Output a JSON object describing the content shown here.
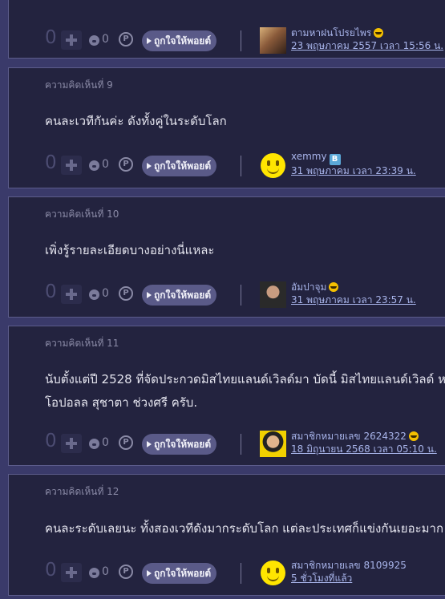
{
  "like_label": "ถูกใจให้พอยต์",
  "comments": [
    {
      "number_label": "",
      "text_lines": [],
      "score": "0",
      "emotion_count": "0",
      "user": "ตามหาฝนโปรยไพร",
      "date": "23 พฤษภาคม 2557 เวลา 15:56 น.",
      "badge_icon": "laughing-face-icon",
      "avatar_icon": "user-photo-avatar"
    },
    {
      "number_label": "ความคิดเห็นที่ 9",
      "text_lines": [
        "คนละเวทีกันค่ะ ดังทั้งคู่ในระดับโลก"
      ],
      "score": "0",
      "emotion_count": "0",
      "user": "xemmy",
      "date": "31 พฤษภาคม เวลา 23:39 น.",
      "badge_icon": "blue-badge-icon",
      "avatar_icon": "smiley-avatar"
    },
    {
      "number_label": "ความคิดเห็นที่ 10",
      "text_lines": [
        "เพิ่งรู้รายละเอียดบางอย่างนี่แหละ"
      ],
      "score": "0",
      "emotion_count": "0",
      "user": "อัมปาจุม",
      "date": "31 พฤษภาคม เวลา 23:57 น.",
      "badge_icon": "laughing-face-icon",
      "avatar_icon": "user-photo-avatar"
    },
    {
      "number_label": "ความคิดเห็นที่ 11",
      "text_lines": [
        "นับตั้งแต่ปี 2528 ที่จัดประกวดมิสไทยแลนด์เวิลด์มา บัดนี้ มิสไทยแลนด์เวิลด์ ห",
        "โอปอลล สุชาตา ช่วงศรี ครับ."
      ],
      "score": "0",
      "emotion_count": "0",
      "user": "สมาชิกหมายเลข 2624322",
      "date": "18 มิถุนายน 2568 เวลา 05:10 น.",
      "badge_icon": "laughing-face-icon",
      "avatar_icon": "user-photo-avatar"
    },
    {
      "number_label": "ความคิดเห็นที่ 12",
      "text_lines": [
        "คนละระดับเลยนะ ทั้งสองเวทีดังมากระดับโลก แต่ละประเทศก็แข่งกันเยอะมาก"
      ],
      "score": "0",
      "emotion_count": "0",
      "user": "สมาชิกหมายเลข 8109925",
      "date": "5 ชั่วโมงที่แล้ว",
      "badge_icon": "",
      "avatar_icon": "smiley-avatar"
    }
  ]
}
